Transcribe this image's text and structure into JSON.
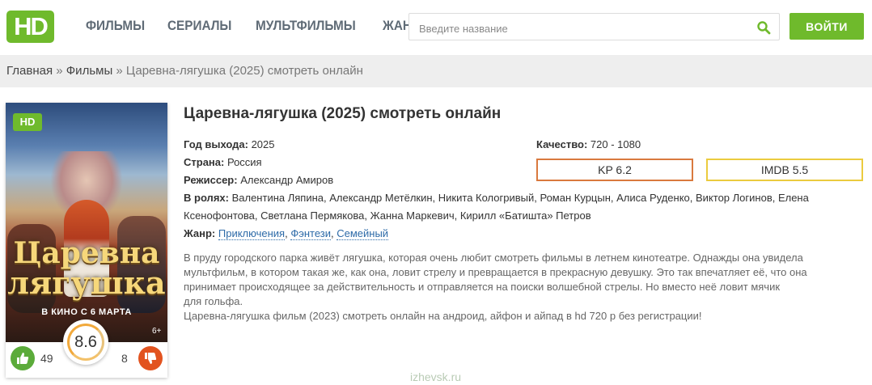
{
  "header": {
    "logo_text": "HD",
    "nav": [
      "ФИЛЬМЫ",
      "СЕРИАЛЫ",
      "МУЛЬТФИЛЬМЫ",
      "ЖАНРЫ"
    ],
    "search_placeholder": "Введите название",
    "login_label": "ВОЙТИ"
  },
  "breadcrumb": {
    "home": "Главная",
    "separator": "»",
    "section": "Фильмы",
    "current": "Царевна-лягушка (2025) смотреть онлайн"
  },
  "poster": {
    "badge": "HD",
    "art_line1": "Царевна",
    "art_line2": "лягушка",
    "release": "В КИНО С 6 МАРТА",
    "age": "6+",
    "score": "8.6",
    "likes": "49",
    "dislikes": "8"
  },
  "details": {
    "title": "Царевна-лягушка (2025) смотреть онлайн",
    "year_label": "Год выхода:",
    "year": "2025",
    "country_label": "Страна:",
    "country": "Россия",
    "director_label": "Режиссер:",
    "director": "Александр Амиров",
    "cast_label": "В ролях:",
    "cast_line1": "Валентина Ляпина, Александр Метёлкин, Никита Кологривый, Роман Курцын, Алиса Руденко, Виктор Логинов, Елена",
    "cast_line2": "Ксенофонтова, Светлана Пермякова, Жанна Маркевич, Кирилл «Батишта» Петров",
    "genre_label": "Жанр:",
    "genres": [
      "Приключения",
      "Фэнтези",
      "Семейный"
    ],
    "quality_label": "Качество:",
    "quality": "720 - 1080",
    "kp": "KP  6.2",
    "imdb": "IMDB  5.5"
  },
  "description": {
    "line1": "В пруду городского парка живёт лягушка, которая очень любит смотреть фильмы в летнем кинотеатре. Однажды она увидела",
    "line2": "мультфильм, в котором такая же, как она, ловит стрелу и превращается в прекрасную девушку. Это так впечатляет её, что она",
    "line3": "принимает происходящее за действительность и отправляется на поиски волшебной стрелы. Но вместо неё ловит мячик",
    "line4": "для гольфа.",
    "line5": "Царевна-лягушка фильм (2023) смотреть онлайн на андроид, айфон и айпад в hd 720 p без регистрации!"
  },
  "watermark": "izhevsk.ru",
  "colors": {
    "brand_green": "#6fba2c",
    "kp_border": "#d9793e",
    "imdb_border": "#ebcb3f",
    "like": "#5bab3a",
    "dislike": "#e2531f"
  }
}
